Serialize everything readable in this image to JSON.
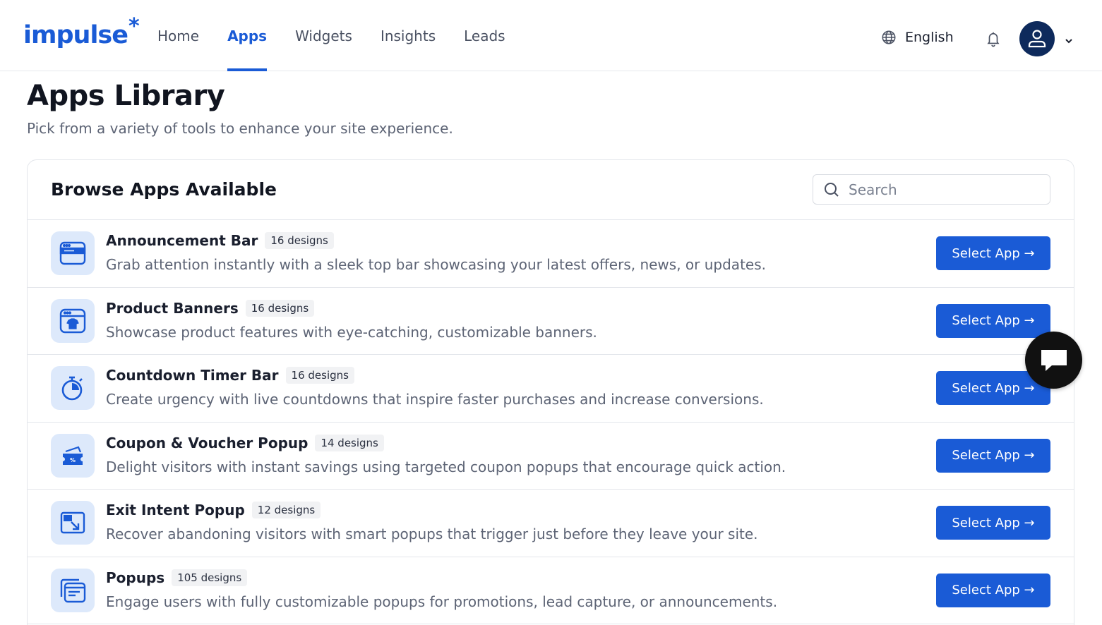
{
  "brand": {
    "logo_text": "impulse",
    "logo_mark": "*",
    "color": "#1a5bd6"
  },
  "nav": {
    "items": [
      {
        "label": "Home",
        "active": false
      },
      {
        "label": "Apps",
        "active": true
      },
      {
        "label": "Widgets",
        "active": false
      },
      {
        "label": "Insights",
        "active": false
      },
      {
        "label": "Leads",
        "active": false
      }
    ],
    "language": "English",
    "icons": {
      "language": "globe-icon",
      "notifications": "bell-icon",
      "account": "user-icon",
      "menu": "chevron-down-icon"
    }
  },
  "page": {
    "title": "Apps Library",
    "subtitle": "Pick from a variety of tools to enhance your site experience."
  },
  "browse": {
    "title": "Browse Apps Available",
    "search_placeholder": "Search",
    "search_value": ""
  },
  "apps": [
    {
      "name": "Announcement Bar",
      "designs": "16 designs",
      "description": "Grab attention instantly with a sleek top bar showcasing your latest offers, news, or updates.",
      "button": "Select App →",
      "icon": "announcement-bar-icon"
    },
    {
      "name": "Product Banners",
      "designs": "16 designs",
      "description": "Showcase product features with eye-catching, customizable banners.",
      "button": "Select App →",
      "icon": "product-banner-icon"
    },
    {
      "name": "Countdown Timer Bar",
      "designs": "16 designs",
      "description": "Create urgency with live countdowns that inspire faster purchases and increase conversions.",
      "button": "Select App →",
      "icon": "stopwatch-icon"
    },
    {
      "name": "Coupon & Voucher Popup",
      "designs": "14 designs",
      "description": "Delight visitors with instant savings using targeted coupon popups that encourage quick action.",
      "button": "Select App →",
      "icon": "coupon-icon"
    },
    {
      "name": "Exit Intent Popup",
      "designs": "12 designs",
      "description": "Recover abandoning visitors with smart popups that trigger just before they leave your site.",
      "button": "Select App →",
      "icon": "exit-popup-icon"
    },
    {
      "name": "Popups",
      "designs": "105 designs",
      "description": "Engage users with fully customizable popups for promotions, lead capture, or announcements.",
      "button": "Select App →",
      "icon": "popup-window-icon"
    }
  ],
  "chat": {
    "icon": "chat-bubble-icon"
  },
  "colors": {
    "primary": "#1a5bd6",
    "icon_bg": "#dde9fb",
    "avatar_bg": "#0e2a5c"
  }
}
